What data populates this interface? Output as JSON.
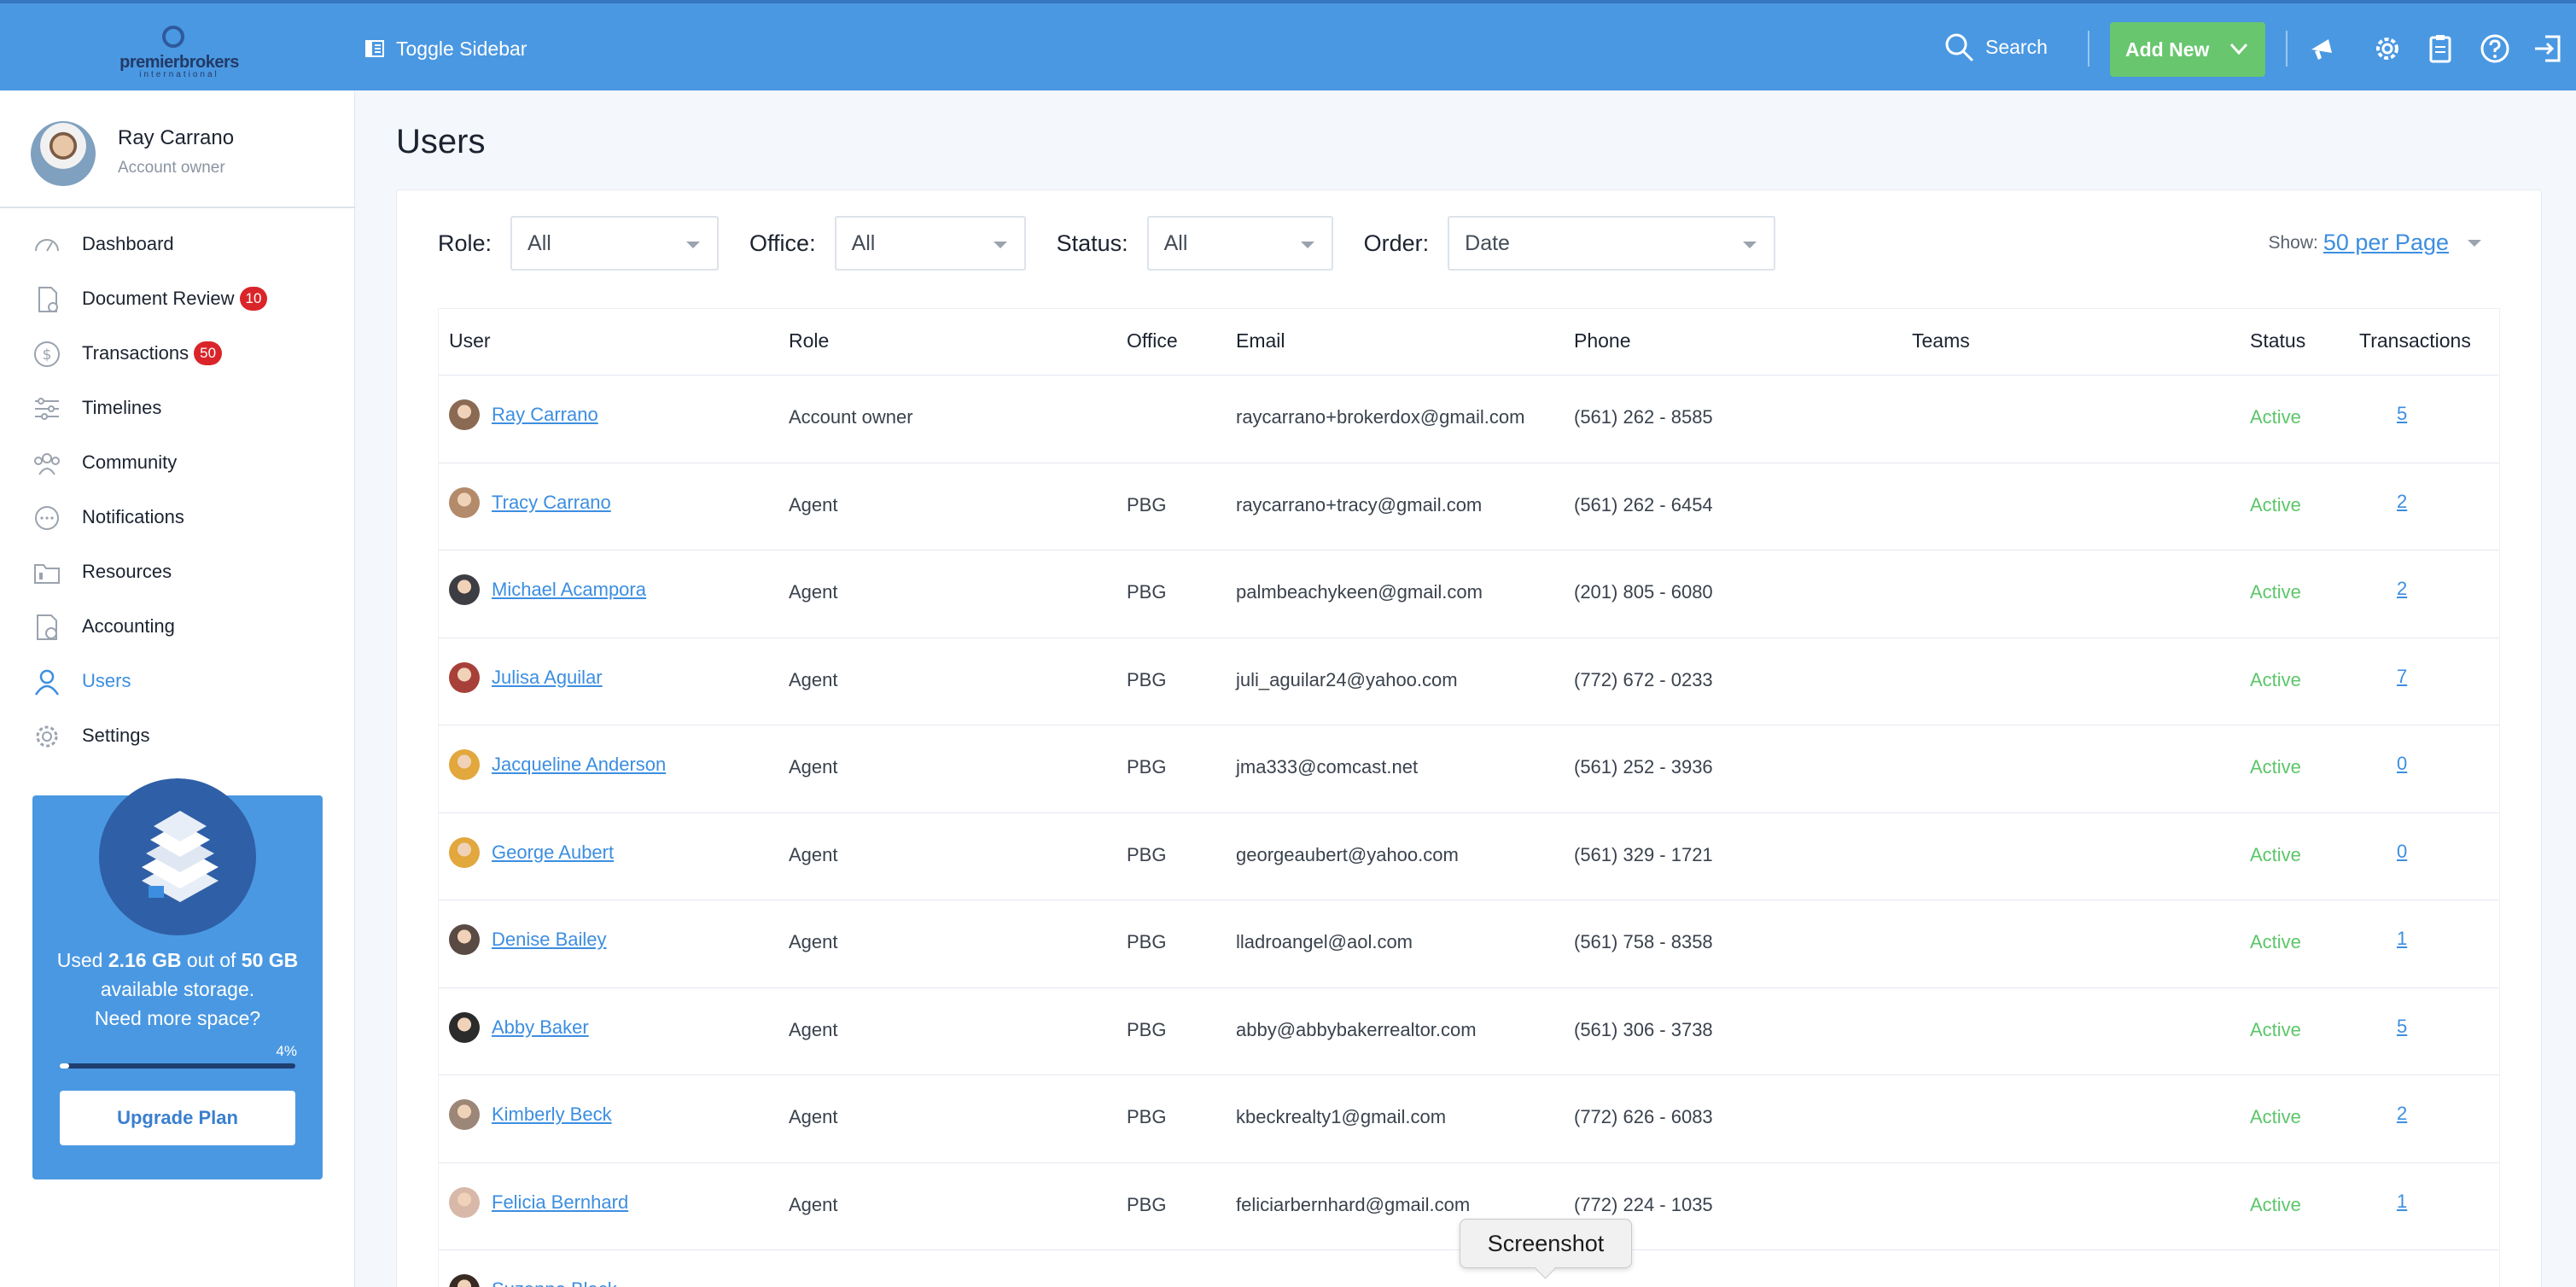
{
  "header": {
    "logo": {
      "wordmark": "premierbrokers",
      "tagline": "international"
    },
    "toggle_sidebar_label": "Toggle Sidebar",
    "search_label": "Search",
    "add_new_label": "Add New",
    "icons": [
      "broadcast-icon",
      "gear-icon",
      "clipboard-icon",
      "help-icon",
      "logout-icon"
    ],
    "brand_color": "#4a98e2",
    "accent_green": "#67c66e"
  },
  "profile": {
    "name": "Ray Carrano",
    "role": "Account owner"
  },
  "sidebar": {
    "items": [
      {
        "label": "Dashboard",
        "icon": "dashboard-icon",
        "badge": null,
        "active": false
      },
      {
        "label": "Document Review",
        "icon": "document-icon",
        "badge": "10",
        "active": false
      },
      {
        "label": "Transactions",
        "icon": "dollar-icon",
        "badge": "50",
        "active": false
      },
      {
        "label": "Timelines",
        "icon": "timeline-icon",
        "badge": null,
        "active": false
      },
      {
        "label": "Community",
        "icon": "community-icon",
        "badge": null,
        "active": false
      },
      {
        "label": "Notifications",
        "icon": "chat-icon",
        "badge": null,
        "active": false
      },
      {
        "label": "Resources",
        "icon": "folder-icon",
        "badge": null,
        "active": false
      },
      {
        "label": "Accounting",
        "icon": "accounting-icon",
        "badge": null,
        "active": false
      },
      {
        "label": "Users",
        "icon": "user-icon",
        "badge": null,
        "active": true
      },
      {
        "label": "Settings",
        "icon": "gear-icon",
        "badge": null,
        "active": false
      }
    ]
  },
  "storage": {
    "text_used": "Used ",
    "used": "2.16 GB",
    "text_outof": " out of ",
    "total": "50 GB",
    "text_available": " available storage.",
    "text_more": "Need more space?",
    "percent_label": "4%",
    "percent": 0.04,
    "upgrade_label": "Upgrade Plan"
  },
  "main": {
    "title": "Users",
    "filters": [
      {
        "label": "Role:",
        "value": "All"
      },
      {
        "label": "Office:",
        "value": "All"
      },
      {
        "label": "Status:",
        "value": "All"
      },
      {
        "label": "Order:",
        "value": "Date"
      }
    ],
    "show_label": "Show:",
    "show_value": "50 per Page",
    "columns": [
      "User",
      "Role",
      "Office",
      "Email",
      "Phone",
      "Teams",
      "Status",
      "Transactions"
    ],
    "rows": [
      {
        "name": "Ray Carrano",
        "role": "Account owner",
        "office": "",
        "email": "raycarrano+brokerdox@gmail.com",
        "phone": "(561) 262 - 8585",
        "teams": "",
        "status": "Active",
        "transactions": "5"
      },
      {
        "name": "Tracy Carrano",
        "role": "Agent",
        "office": "PBG",
        "email": "raycarrano+tracy@gmail.com",
        "phone": "(561) 262 - 6454",
        "teams": "",
        "status": "Active",
        "transactions": "2"
      },
      {
        "name": "Michael Acampora",
        "role": "Agent",
        "office": "PBG",
        "email": "palmbeachykeen@gmail.com",
        "phone": "(201) 805 - 6080",
        "teams": "",
        "status": "Active",
        "transactions": "2"
      },
      {
        "name": "Julisa Aguilar",
        "role": "Agent",
        "office": "PBG",
        "email": "juli_aguilar24@yahoo.com",
        "phone": "(772) 672 - 0233",
        "teams": "",
        "status": "Active",
        "transactions": "7"
      },
      {
        "name": "Jacqueline Anderson",
        "role": "Agent",
        "office": "PBG",
        "email": "jma333@comcast.net",
        "phone": "(561) 252 - 3936",
        "teams": "",
        "status": "Active",
        "transactions": "0"
      },
      {
        "name": "George Aubert",
        "role": "Agent",
        "office": "PBG",
        "email": "georgeaubert@yahoo.com",
        "phone": "(561) 329 - 1721",
        "teams": "",
        "status": "Active",
        "transactions": "0"
      },
      {
        "name": "Denise Bailey",
        "role": "Agent",
        "office": "PBG",
        "email": "lladroangel@aol.com",
        "phone": "(561) 758 - 8358",
        "teams": "",
        "status": "Active",
        "transactions": "1"
      },
      {
        "name": "Abby Baker",
        "role": "Agent",
        "office": "PBG",
        "email": "abby@abbybakerrealtor.com",
        "phone": "(561) 306 - 3738",
        "teams": "",
        "status": "Active",
        "transactions": "5"
      },
      {
        "name": "Kimberly Beck",
        "role": "Agent",
        "office": "PBG",
        "email": "kbeckrealty1@gmail.com",
        "phone": "(772) 626 - 6083",
        "teams": "",
        "status": "Active",
        "transactions": "2"
      },
      {
        "name": "Felicia Bernhard",
        "role": "Agent",
        "office": "PBG",
        "email": "feliciarbernhard@gmail.com",
        "phone": "(772) 224 - 1035",
        "teams": "",
        "status": "Active",
        "transactions": "1"
      },
      {
        "name": "Suzanne Black",
        "role": "",
        "office": "",
        "email": "",
        "phone": "",
        "teams": "",
        "status": "",
        "transactions": ""
      }
    ]
  },
  "tooltip": {
    "label": "Screenshot"
  }
}
